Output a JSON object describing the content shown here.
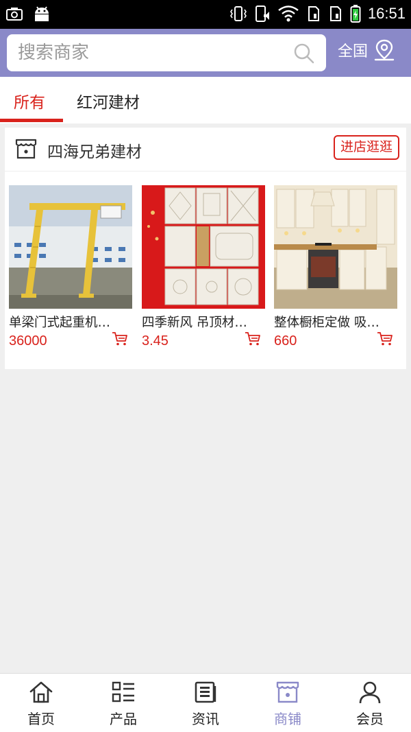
{
  "status_bar": {
    "time": "16:51"
  },
  "search": {
    "placeholder": "搜索商家",
    "region_label": "全国"
  },
  "tabs": [
    {
      "label": "所有",
      "active": true
    },
    {
      "label": "红河建材",
      "active": false
    }
  ],
  "store": {
    "name": "四海兄弟建材",
    "visit_label": "进店逛逛",
    "products": [
      {
        "name": "单梁门式起重机…",
        "price": "36000"
      },
      {
        "name": "四季新风 吊顶材…",
        "price": "3.45"
      },
      {
        "name": "整体橱柜定做 吸…",
        "price": "660"
      }
    ]
  },
  "bottom_nav": [
    {
      "label": "首页",
      "icon": "home-icon"
    },
    {
      "label": "产品",
      "icon": "grid-list-icon"
    },
    {
      "label": "资讯",
      "icon": "news-icon"
    },
    {
      "label": "商铺",
      "icon": "shop-icon",
      "active": true
    },
    {
      "label": "会员",
      "icon": "user-icon"
    }
  ],
  "colors": {
    "accent": "#8a89c8",
    "brand_red": "#d9221c",
    "background": "#efefef"
  }
}
